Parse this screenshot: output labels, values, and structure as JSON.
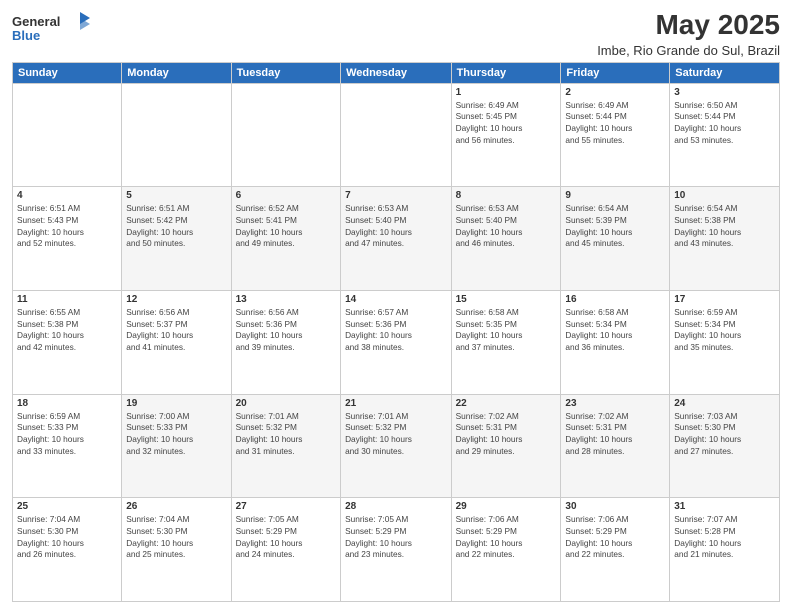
{
  "logo": {
    "general": "General",
    "blue": "Blue"
  },
  "header": {
    "month": "May 2025",
    "location": "Imbe, Rio Grande do Sul, Brazil"
  },
  "weekdays": [
    "Sunday",
    "Monday",
    "Tuesday",
    "Wednesday",
    "Thursday",
    "Friday",
    "Saturday"
  ],
  "weeks": [
    [
      {
        "day": "",
        "info": ""
      },
      {
        "day": "",
        "info": ""
      },
      {
        "day": "",
        "info": ""
      },
      {
        "day": "",
        "info": ""
      },
      {
        "day": "1",
        "info": "Sunrise: 6:49 AM\nSunset: 5:45 PM\nDaylight: 10 hours\nand 56 minutes."
      },
      {
        "day": "2",
        "info": "Sunrise: 6:49 AM\nSunset: 5:44 PM\nDaylight: 10 hours\nand 55 minutes."
      },
      {
        "day": "3",
        "info": "Sunrise: 6:50 AM\nSunset: 5:44 PM\nDaylight: 10 hours\nand 53 minutes."
      }
    ],
    [
      {
        "day": "4",
        "info": "Sunrise: 6:51 AM\nSunset: 5:43 PM\nDaylight: 10 hours\nand 52 minutes."
      },
      {
        "day": "5",
        "info": "Sunrise: 6:51 AM\nSunset: 5:42 PM\nDaylight: 10 hours\nand 50 minutes."
      },
      {
        "day": "6",
        "info": "Sunrise: 6:52 AM\nSunset: 5:41 PM\nDaylight: 10 hours\nand 49 minutes."
      },
      {
        "day": "7",
        "info": "Sunrise: 6:53 AM\nSunset: 5:40 PM\nDaylight: 10 hours\nand 47 minutes."
      },
      {
        "day": "8",
        "info": "Sunrise: 6:53 AM\nSunset: 5:40 PM\nDaylight: 10 hours\nand 46 minutes."
      },
      {
        "day": "9",
        "info": "Sunrise: 6:54 AM\nSunset: 5:39 PM\nDaylight: 10 hours\nand 45 minutes."
      },
      {
        "day": "10",
        "info": "Sunrise: 6:54 AM\nSunset: 5:38 PM\nDaylight: 10 hours\nand 43 minutes."
      }
    ],
    [
      {
        "day": "11",
        "info": "Sunrise: 6:55 AM\nSunset: 5:38 PM\nDaylight: 10 hours\nand 42 minutes."
      },
      {
        "day": "12",
        "info": "Sunrise: 6:56 AM\nSunset: 5:37 PM\nDaylight: 10 hours\nand 41 minutes."
      },
      {
        "day": "13",
        "info": "Sunrise: 6:56 AM\nSunset: 5:36 PM\nDaylight: 10 hours\nand 39 minutes."
      },
      {
        "day": "14",
        "info": "Sunrise: 6:57 AM\nSunset: 5:36 PM\nDaylight: 10 hours\nand 38 minutes."
      },
      {
        "day": "15",
        "info": "Sunrise: 6:58 AM\nSunset: 5:35 PM\nDaylight: 10 hours\nand 37 minutes."
      },
      {
        "day": "16",
        "info": "Sunrise: 6:58 AM\nSunset: 5:34 PM\nDaylight: 10 hours\nand 36 minutes."
      },
      {
        "day": "17",
        "info": "Sunrise: 6:59 AM\nSunset: 5:34 PM\nDaylight: 10 hours\nand 35 minutes."
      }
    ],
    [
      {
        "day": "18",
        "info": "Sunrise: 6:59 AM\nSunset: 5:33 PM\nDaylight: 10 hours\nand 33 minutes."
      },
      {
        "day": "19",
        "info": "Sunrise: 7:00 AM\nSunset: 5:33 PM\nDaylight: 10 hours\nand 32 minutes."
      },
      {
        "day": "20",
        "info": "Sunrise: 7:01 AM\nSunset: 5:32 PM\nDaylight: 10 hours\nand 31 minutes."
      },
      {
        "day": "21",
        "info": "Sunrise: 7:01 AM\nSunset: 5:32 PM\nDaylight: 10 hours\nand 30 minutes."
      },
      {
        "day": "22",
        "info": "Sunrise: 7:02 AM\nSunset: 5:31 PM\nDaylight: 10 hours\nand 29 minutes."
      },
      {
        "day": "23",
        "info": "Sunrise: 7:02 AM\nSunset: 5:31 PM\nDaylight: 10 hours\nand 28 minutes."
      },
      {
        "day": "24",
        "info": "Sunrise: 7:03 AM\nSunset: 5:30 PM\nDaylight: 10 hours\nand 27 minutes."
      }
    ],
    [
      {
        "day": "25",
        "info": "Sunrise: 7:04 AM\nSunset: 5:30 PM\nDaylight: 10 hours\nand 26 minutes."
      },
      {
        "day": "26",
        "info": "Sunrise: 7:04 AM\nSunset: 5:30 PM\nDaylight: 10 hours\nand 25 minutes."
      },
      {
        "day": "27",
        "info": "Sunrise: 7:05 AM\nSunset: 5:29 PM\nDaylight: 10 hours\nand 24 minutes."
      },
      {
        "day": "28",
        "info": "Sunrise: 7:05 AM\nSunset: 5:29 PM\nDaylight: 10 hours\nand 23 minutes."
      },
      {
        "day": "29",
        "info": "Sunrise: 7:06 AM\nSunset: 5:29 PM\nDaylight: 10 hours\nand 22 minutes."
      },
      {
        "day": "30",
        "info": "Sunrise: 7:06 AM\nSunset: 5:29 PM\nDaylight: 10 hours\nand 22 minutes."
      },
      {
        "day": "31",
        "info": "Sunrise: 7:07 AM\nSunset: 5:28 PM\nDaylight: 10 hours\nand 21 minutes."
      }
    ]
  ]
}
